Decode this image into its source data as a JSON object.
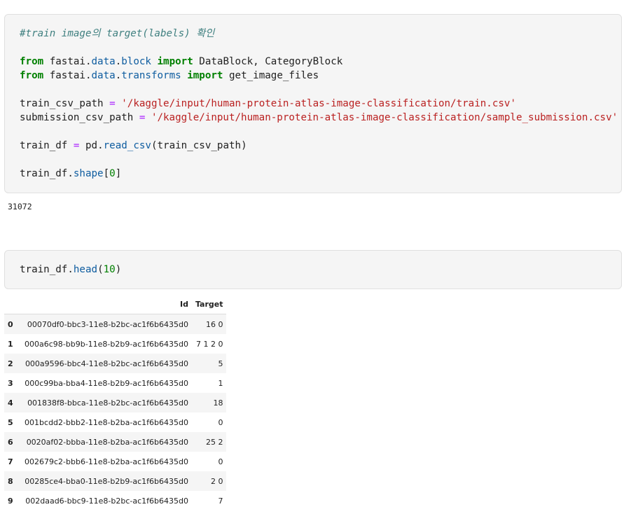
{
  "cell1": {
    "comment": "#train image의 target(labels) 확인",
    "import1": {
      "kw_from": "from",
      "mod_a": "fastai",
      "mod_b": "data",
      "mod_c": "block",
      "kw_import": "import",
      "names": "DataBlock, CategoryBlock"
    },
    "import2": {
      "kw_from": "from",
      "mod_a": "fastai",
      "mod_b": "data",
      "mod_c": "transforms",
      "kw_import": "import",
      "names": "get_image_files"
    },
    "line_train_path": {
      "var": "train_csv_path",
      "op": "=",
      "value": "'/kaggle/input/human-protein-atlas-image-classification/train.csv'"
    },
    "line_sub_path": {
      "var": "submission_csv_path",
      "op": "=",
      "value": "'/kaggle/input/human-protein-atlas-image-classification/sample_submission.csv'"
    },
    "line_read": {
      "var": "train_df",
      "op": "=",
      "obj": "pd",
      "fn": "read_csv",
      "arg": "(train_csv_path)"
    },
    "line_shape": {
      "obj": "train_df",
      "attr": "shape",
      "idx_open": "[",
      "idx": "0",
      "idx_close": "]"
    }
  },
  "output1": "31072",
  "cell2": {
    "obj": "train_df",
    "fn": "head",
    "arg_open": "(",
    "arg": "10",
    "arg_close": ")"
  },
  "table": {
    "columns": [
      "Id",
      "Target"
    ],
    "rows": [
      {
        "index": "0",
        "id": "00070df0-bbc3-11e8-b2bc-ac1f6b6435d0",
        "target": "16 0"
      },
      {
        "index": "1",
        "id": "000a6c98-bb9b-11e8-b2b9-ac1f6b6435d0",
        "target": "7 1 2 0"
      },
      {
        "index": "2",
        "id": "000a9596-bbc4-11e8-b2bc-ac1f6b6435d0",
        "target": "5"
      },
      {
        "index": "3",
        "id": "000c99ba-bba4-11e8-b2b9-ac1f6b6435d0",
        "target": "1"
      },
      {
        "index": "4",
        "id": "001838f8-bbca-11e8-b2bc-ac1f6b6435d0",
        "target": "18"
      },
      {
        "index": "5",
        "id": "001bcdd2-bbb2-11e8-b2ba-ac1f6b6435d0",
        "target": "0"
      },
      {
        "index": "6",
        "id": "0020af02-bbba-11e8-b2ba-ac1f6b6435d0",
        "target": "25 2"
      },
      {
        "index": "7",
        "id": "002679c2-bbb6-11e8-b2ba-ac1f6b6435d0",
        "target": "0"
      },
      {
        "index": "8",
        "id": "00285ce4-bba0-11e8-b2b9-ac1f6b6435d0",
        "target": "2 0"
      },
      {
        "index": "9",
        "id": "002daad6-bbc9-11e8-b2bc-ac1f6b6435d0",
        "target": "7"
      }
    ]
  }
}
